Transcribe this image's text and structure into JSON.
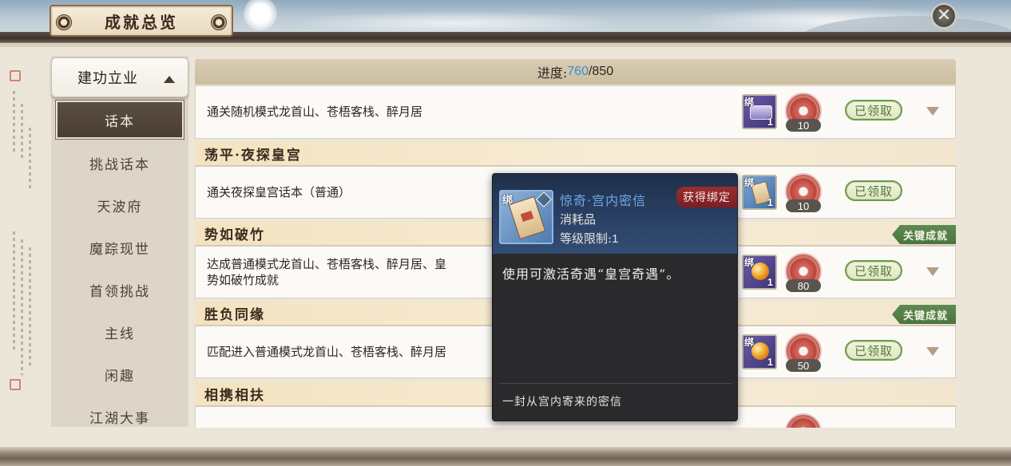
{
  "header": {
    "title": "成就总览",
    "close_icon": "close-x-icon"
  },
  "nav": {
    "category": "建功立业",
    "items": [
      {
        "label": "话本",
        "active": true
      },
      {
        "label": "挑战话本"
      },
      {
        "label": "天波府"
      },
      {
        "label": "魔踪现世"
      },
      {
        "label": "首领挑战"
      },
      {
        "label": "主线"
      },
      {
        "label": "闲趣"
      },
      {
        "label": "江湖大事"
      }
    ]
  },
  "progress": {
    "label": "进度:",
    "current": "760",
    "total": "/850"
  },
  "achievements": [
    {
      "title": "",
      "desc": "通关随机模式龙首山、苍梧客栈、醉月居",
      "item_bind": "绑",
      "item_count": "1",
      "coin_count": "10",
      "status": "已领取"
    },
    {
      "title": "荡平·夜探皇宫",
      "desc": "通关夜探皇宫话本（普通）",
      "item_bind": "绑",
      "item_count": "1",
      "coin_count": "10",
      "status": "已领取"
    },
    {
      "title": "势如破竹",
      "key": "关键成就",
      "desc": "达成普通模式龙首山、苍梧客栈、醉月居、皇",
      "desc2": "势如破竹成就",
      "item_bind": "绑",
      "item_count": "1",
      "coin_count": "80",
      "status": "已领取"
    },
    {
      "title": "胜负同缘",
      "key": "关键成就",
      "desc": "匹配进入普通模式龙首山、苍梧客栈、醉月居",
      "item_bind": "绑",
      "item_count": "1",
      "coin_count": "50",
      "status": "已领取"
    },
    {
      "title": "相携相扶"
    }
  ],
  "tooltip": {
    "bind": "绑",
    "name": "惊奇·宫内密信",
    "bind_tag": "获得绑定",
    "type": "消耗品",
    "level_label": "等级限制:",
    "level_value": "1",
    "desc": "使用可激活奇遇“皇宫奇遇”。",
    "footer": "一封从宫内寄来的密信"
  }
}
